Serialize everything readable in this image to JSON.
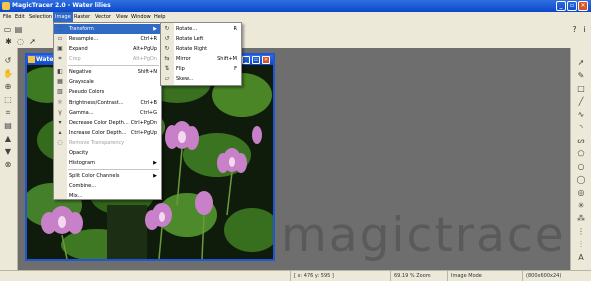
{
  "window": {
    "title": "MagicTracer 2.0 - Water lilies"
  },
  "menubar": {
    "items": [
      "File",
      "Edit",
      "Selection",
      "Image",
      "Raster",
      "Vector",
      "View",
      "Window",
      "Help"
    ],
    "active": "Image"
  },
  "document": {
    "title": "Water lilies"
  },
  "image_menu": {
    "items": [
      {
        "label": "Transform",
        "shortcut": "",
        "icon": "transform-icon",
        "state": "selected",
        "submenu": true
      },
      {
        "label": "Resample...",
        "shortcut": "Ctrl+R",
        "icon": "resample-icon",
        "state": "normal"
      },
      {
        "label": "Expand",
        "shortcut": "Alt+PgUp",
        "icon": "expand-icon",
        "state": "normal"
      },
      {
        "label": "Crop",
        "shortcut": "Alt+PgDn",
        "icon": "crop-icon",
        "state": "disabled"
      },
      {
        "label": "Negative",
        "shortcut": "Shift+N",
        "icon": "negative-icon",
        "state": "normal"
      },
      {
        "label": "Grayscale",
        "shortcut": "",
        "icon": "grayscale-icon",
        "state": "normal"
      },
      {
        "label": "Pseudo Colors",
        "shortcut": "",
        "icon": "pseudo-colors-icon",
        "state": "normal"
      },
      {
        "label": "Brightness/Contrast...",
        "shortcut": "Ctrl+B",
        "icon": "brightness-icon",
        "state": "normal"
      },
      {
        "label": "Gamma...",
        "shortcut": "Ctrl+G",
        "icon": "gamma-icon",
        "state": "normal"
      },
      {
        "label": "Decrease Color Depth...",
        "shortcut": "Ctrl+PgDn",
        "icon": "decrease-depth-icon",
        "state": "normal"
      },
      {
        "label": "Increase Color Depth...",
        "shortcut": "Ctrl+PgUp",
        "icon": "increase-depth-icon",
        "state": "normal"
      },
      {
        "label": "Remove Transparency",
        "shortcut": "",
        "icon": "remove-transparency-icon",
        "state": "disabled"
      },
      {
        "label": "Opacity",
        "shortcut": "",
        "icon": "",
        "state": "normal"
      },
      {
        "label": "Histogram",
        "shortcut": "",
        "icon": "",
        "state": "normal",
        "submenu": true
      },
      {
        "label": "Split Color Channels",
        "shortcut": "",
        "icon": "",
        "state": "normal",
        "submenu": true
      },
      {
        "label": "Combine...",
        "shortcut": "",
        "icon": "",
        "state": "normal"
      },
      {
        "label": "Mix...",
        "shortcut": "",
        "icon": "",
        "state": "normal"
      }
    ]
  },
  "transform_menu": {
    "items": [
      {
        "label": "Rotate...",
        "shortcut": "R",
        "icon": "rotate-icon"
      },
      {
        "label": "Rotate Left",
        "shortcut": "",
        "icon": "rotate-left-icon"
      },
      {
        "label": "Rotate Right",
        "shortcut": "",
        "icon": "rotate-right-icon"
      },
      {
        "label": "Mirror",
        "shortcut": "Shift+M",
        "icon": "mirror-icon"
      },
      {
        "label": "Flip",
        "shortcut": "F",
        "icon": "flip-icon"
      },
      {
        "label": "Skew...",
        "shortcut": "",
        "icon": "skew-icon"
      }
    ]
  },
  "statusbar": {
    "coords": "[ x: 476 y: 595 ]",
    "zoom": "69.19 % Zoom",
    "mode": "Image Mode",
    "size": "(800x600x24)"
  },
  "watermark": "magictracer",
  "colors": {
    "titlebar": "#0b47c9",
    "menu_highlight": "#316ac5",
    "chrome": "#ece9d8",
    "workspace": "#6e6e6e"
  }
}
